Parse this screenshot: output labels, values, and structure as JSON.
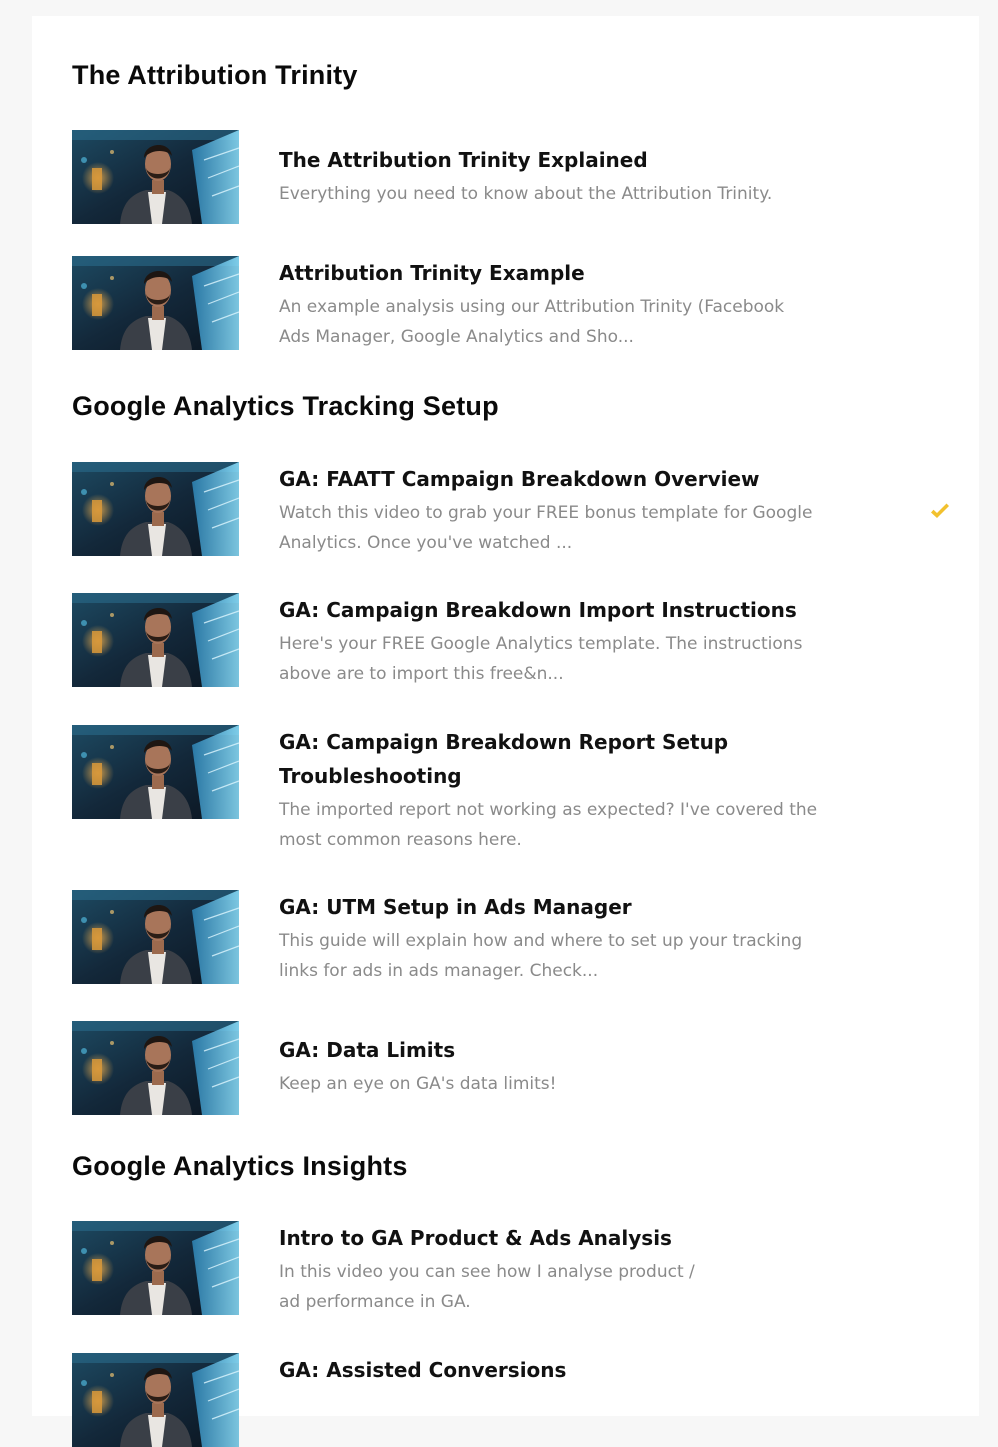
{
  "sections": [
    {
      "title": "The Attribution Trinity",
      "lessons": [
        {
          "title": "The Attribution Trinity Explained",
          "description": "Everything you need to know about the Attribution Trinity.",
          "completed": false
        },
        {
          "title": "Attribution Trinity Example",
          "description": "An example analysis using our Attribution Trinity (Facebook Ads Manager, Google Analytics and Sho...",
          "completed": false
        }
      ]
    },
    {
      "title": "Google Analytics Tracking Setup",
      "lessons": [
        {
          "title": "GA: FAATT Campaign Breakdown Overview",
          "description": "Watch this video to grab your FREE bonus template for Google Analytics. Once you've watched ...",
          "completed": true
        },
        {
          "title": "GA: Campaign Breakdown Import Instructions",
          "description": "Here's your FREE Google Analytics template. The instructions above are to import this free&n...",
          "completed": false
        },
        {
          "title": "GA: Campaign Breakdown Report Setup Troubleshooting",
          "description": "The imported report not working as expected? I've covered the most common reasons here.",
          "completed": false
        },
        {
          "title": "GA: UTM Setup in Ads Manager",
          "description": "This guide will explain how and where to set up your tracking links for ads in ads manager. Check...",
          "completed": false
        },
        {
          "title": "GA: Data Limits",
          "description": "Keep an eye on GA's data limits!",
          "completed": false
        }
      ]
    },
    {
      "title": "Google Analytics Insights",
      "lessons": [
        {
          "title": "Intro to GA Product & Ads Analysis",
          "description": "In this video you can see how I analyse product / ad performance in GA.",
          "completed": false
        },
        {
          "title": "GA: Assisted Conversions",
          "description": "",
          "completed": false
        }
      ]
    }
  ],
  "colors": {
    "check": "#f2c12e",
    "title": "#111111",
    "description": "#8a8a8a",
    "background": "#f7f7f7",
    "card": "#ffffff"
  },
  "icons": {
    "thumbnail": "presenter-thumbnail",
    "complete": "checkmark-icon"
  }
}
